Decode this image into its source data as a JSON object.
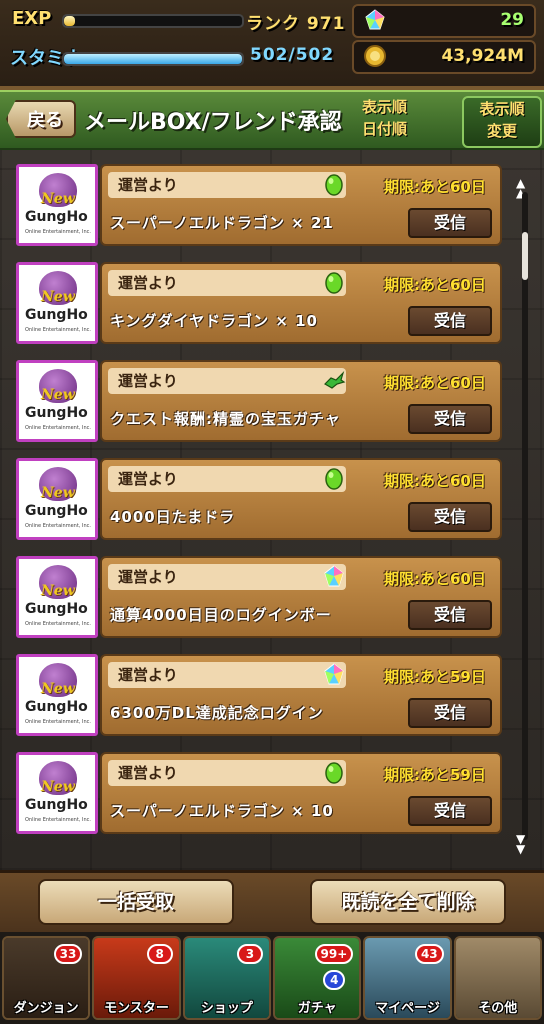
{
  "status": {
    "exp_label": "EXP",
    "rank_text": "ランク 971",
    "exp_fill": 0.06,
    "stamina_label": "スタミナ",
    "stamina_text": "502/502",
    "stamina_fill": 1.0,
    "magic_stones": "29",
    "coins": "43,924M"
  },
  "header": {
    "back_label": "戻る",
    "title": "メールBOX/フレンド承認",
    "sort_label_line1": "表示順",
    "sort_label_line2": "日付順",
    "sort_change_line1": "表示順",
    "sort_change_line2": "変更"
  },
  "thumb": {
    "new_text": "New",
    "brand_text": "GungHo",
    "sub_text": "Online Entertainment, Inc."
  },
  "mails": [
    {
      "sender": "運営より",
      "icon": "egg-icon",
      "deadline": "期限:あと60日",
      "subject": "スーパーノエルドラゴン × 21",
      "button": "受信"
    },
    {
      "sender": "運営より",
      "icon": "egg-icon",
      "deadline": "期限:あと60日",
      "subject": "キングダイヤドラゴン × 10",
      "button": "受信"
    },
    {
      "sender": "運営より",
      "icon": "dragon-icon",
      "deadline": "期限:あと60日",
      "subject": "クエスト報酬:精霊の宝玉ガチャ",
      "button": "受信"
    },
    {
      "sender": "運営より",
      "icon": "egg-icon",
      "deadline": "期限:あと60日",
      "subject": "4000日たまドラ",
      "button": "受信"
    },
    {
      "sender": "運営より",
      "icon": "magic-stone-icon",
      "deadline": "期限:あと60日",
      "subject": "通算4000日目のログインボー",
      "button": "受信"
    },
    {
      "sender": "運営より",
      "icon": "magic-stone-icon",
      "deadline": "期限:あと59日",
      "subject": "6300万DL達成記念ログイン",
      "button": "受信"
    },
    {
      "sender": "運営より",
      "icon": "egg-icon",
      "deadline": "期限:あと59日",
      "subject": "スーパーノエルドラゴン × 10",
      "button": "受信"
    }
  ],
  "actions": {
    "receive_all": "一括受取",
    "delete_read": "既読を全て削除"
  },
  "nav": [
    {
      "label": "ダンジョン",
      "badge": "33",
      "icon": "dungeon-icon"
    },
    {
      "label": "モンスター",
      "badge": "8",
      "icon": "monster-icon"
    },
    {
      "label": "ショップ",
      "badge": "3",
      "icon": "shop-icon"
    },
    {
      "label": "ガチャ",
      "badge": "99+",
      "badge2": "4",
      "icon": "gacha-icon"
    },
    {
      "label": "マイページ",
      "badge": "43",
      "icon": "mypage-icon"
    },
    {
      "label": "その他",
      "badge": "",
      "icon": "other-icon"
    }
  ],
  "colors": {
    "accent_green": "#2f5a20",
    "panel_brown": "#a06c30",
    "deadline_yellow": "#ffe030",
    "badge_red": "#d81818"
  }
}
